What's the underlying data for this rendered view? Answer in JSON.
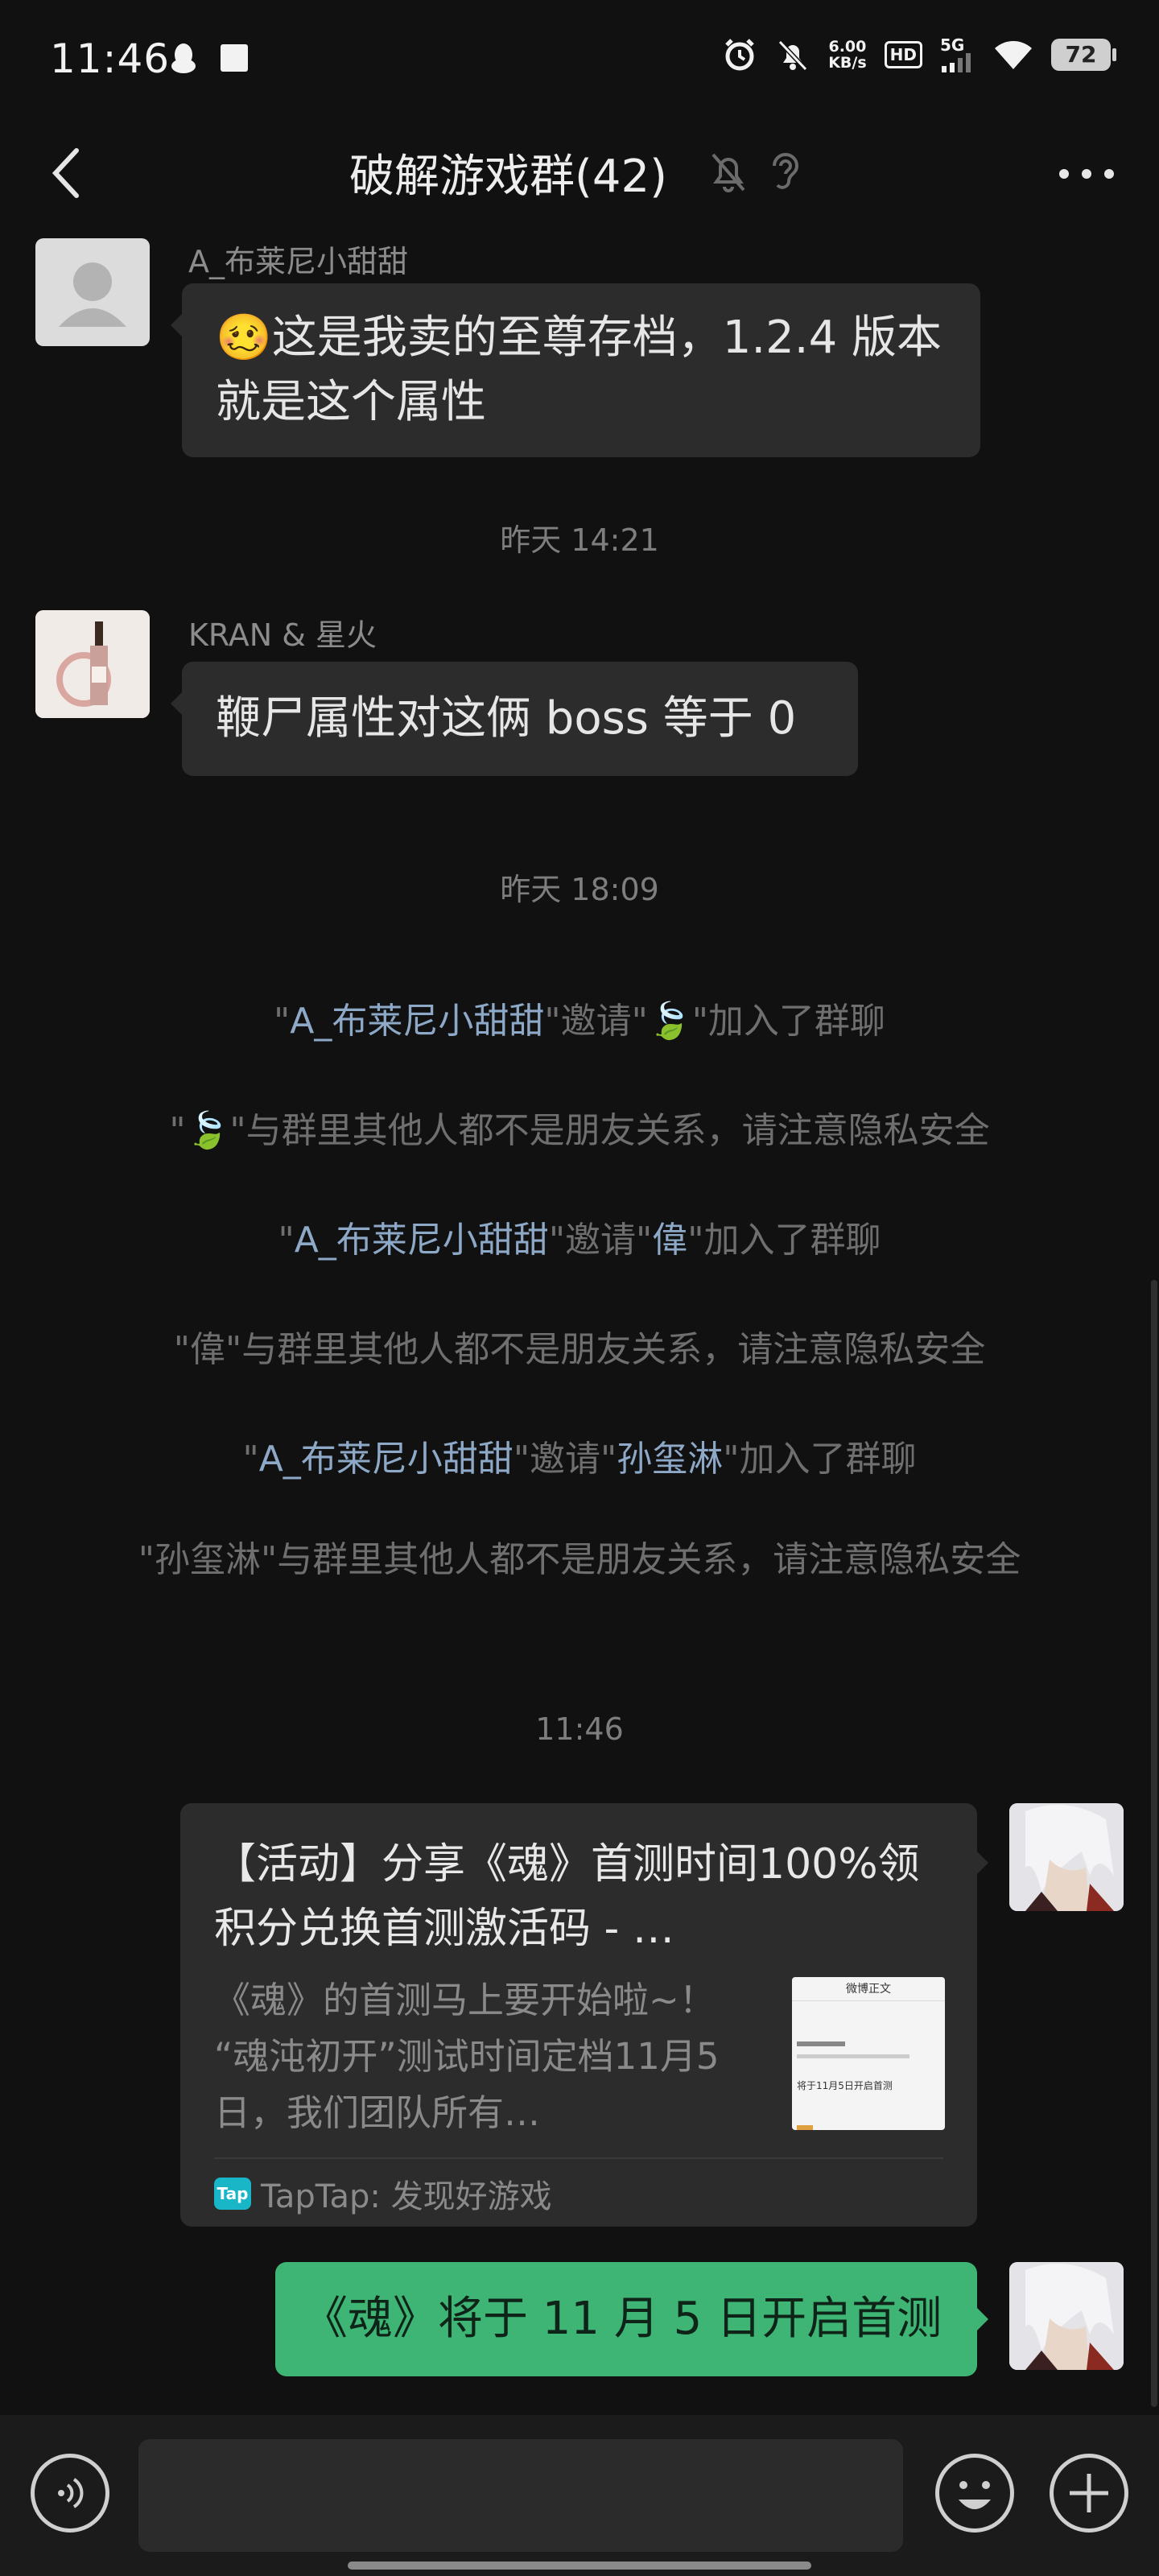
{
  "status_bar": {
    "time": "11:46",
    "net_speed_value": "6.00",
    "net_speed_unit": "KB/s",
    "hd_label": "HD",
    "network_label": "5G",
    "battery": "72"
  },
  "header": {
    "title": "破解游戏群(42)"
  },
  "messages": {
    "m1": {
      "sender": "A_布莱尼小甜甜",
      "emoji": "🥴",
      "text": "这是我卖的至尊存档，1.2.4 版本就是这个属性"
    },
    "time1": "昨天 14:21",
    "m2": {
      "sender": "KRAN & 星火",
      "text": "鞭尸属性对这俩 boss 等于 0"
    },
    "time2": "昨天 18:09",
    "sys1": {
      "a": "\"",
      "b": "A_布莱尼小甜甜",
      "c": "\"邀请\"",
      "d": "🍃",
      "e": "\"加入了群聊"
    },
    "sys2": {
      "a": "\"",
      "b": "🍃",
      "c": "\"与群里其他人都不是朋友关系，请注意隐私安全"
    },
    "sys3": {
      "a": "\"",
      "b": "A_布莱尼小甜甜",
      "c": "\"邀请\"",
      "d": "偉",
      "e": "\"加入了群聊"
    },
    "sys4": "\"偉\"与群里其他人都不是朋友关系，请注意隐私安全",
    "sys5": {
      "a": "\"",
      "b": "A_布莱尼小甜甜",
      "c": "\"邀请\"",
      "d": "孙玺淋",
      "e": "\"加入了群聊"
    },
    "sys6": "\"孙玺淋\"与群里其他人都不是朋友关系，请注意隐私安全",
    "time3": "11:46",
    "link_card": {
      "title": "【活动】分享《魂》首测时间100%领积分兑换首测激活码 - …",
      "description": "《魂》的首测马上要开始啦~！ “魂沌初开”测试时间定档11月5日，我们团队所有…",
      "thumb_header": "微博正文",
      "thumb_text": "将于11月5日开启首测",
      "source_logo": "Tap",
      "source": "TapTap: 发现好游戏"
    },
    "m_self": {
      "text": "《魂》将于 11 月 5 日开启首测"
    }
  },
  "colors": {
    "background": "#111111",
    "bubble": "#2c2c2c",
    "self_bubble": "#3eb575",
    "link_highlight": "#8ea9c8"
  },
  "icons": {
    "back": "back-arrow-icon",
    "mute": "mute-bell-icon",
    "ear": "ear-icon",
    "more": "more-dots-icon",
    "voice": "voice-icon",
    "emoji": "emoji-icon",
    "plus": "plus-icon"
  }
}
